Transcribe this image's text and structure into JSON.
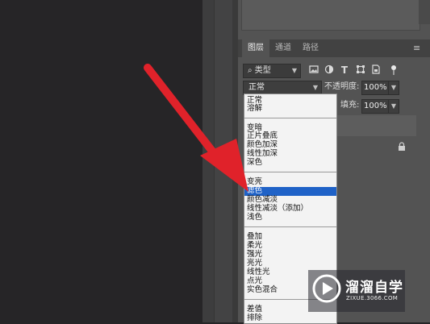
{
  "panel_tabs": [
    "图层",
    "通道",
    "路径"
  ],
  "filter": {
    "label": "类型",
    "prefix_icon": "search-icon"
  },
  "filter_icons": [
    "image-filter-icon",
    "adjustment-filter-icon",
    "type-filter-icon",
    "shape-filter-icon",
    "smart-object-filter-icon",
    "toggle-filter-icon"
  ],
  "blend_select": {
    "value": "正常"
  },
  "opacity": {
    "label": "不透明度:",
    "value": "100%"
  },
  "fill": {
    "label": "填充:",
    "value": "100%"
  },
  "blend_modes": {
    "group1": [
      "正常",
      "溶解"
    ],
    "group2": [
      "变暗",
      "正片叠底",
      "颜色加深",
      "线性加深",
      "深色"
    ],
    "group3": [
      "变亮",
      "滤色",
      "颜色减淡",
      "线性减淡（添加）",
      "浅色"
    ],
    "group4": [
      "叠加",
      "柔光",
      "强光",
      "亮光",
      "线性光",
      "点光",
      "实色混合"
    ],
    "group5": [
      "差值",
      "排除"
    ],
    "selected": "滤色"
  },
  "watermark": {
    "title": "溜溜自学",
    "url": "ZIXUE.3066.COM"
  },
  "colors": {
    "arrow": "#e0222a",
    "selection": "#1f62c7",
    "panel": "#535353",
    "canvas": "#262527"
  }
}
